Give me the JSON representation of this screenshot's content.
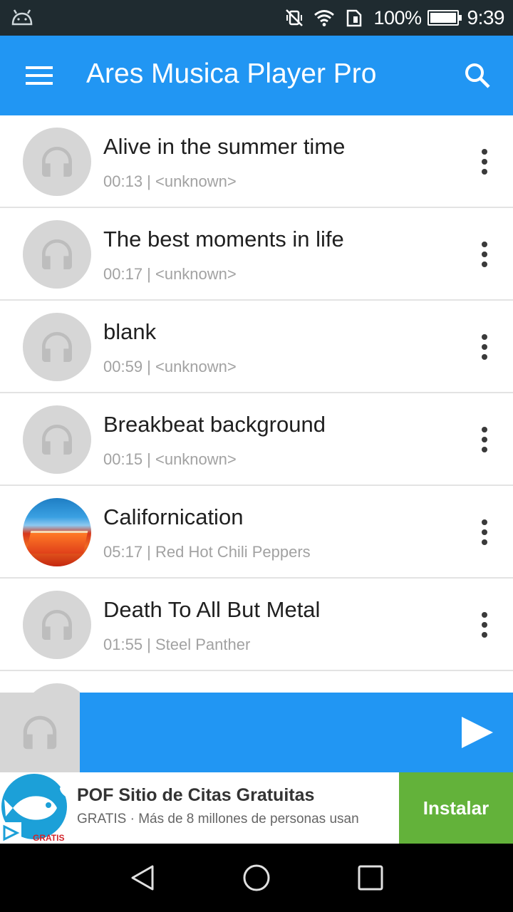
{
  "status_bar": {
    "battery_percent": "100%",
    "time": "9:39",
    "icons": [
      "android-debug-icon",
      "mute-vibrate-icon",
      "wifi-icon",
      "sim-icon",
      "battery-icon"
    ]
  },
  "app_bar": {
    "title": "Ares Musica Player Pro",
    "icons": [
      "menu-icon",
      "search-icon"
    ]
  },
  "songs": [
    {
      "title": "Alive in the summer time",
      "meta": "00:13 | <unknown>",
      "art": "headphones-placeholder"
    },
    {
      "title": "The best moments in life",
      "meta": "00:17 | <unknown>",
      "art": "headphones-placeholder"
    },
    {
      "title": "blank",
      "meta": "00:59 | <unknown>",
      "art": "headphones-placeholder"
    },
    {
      "title": "Breakbeat background",
      "meta": "00:15 | <unknown>",
      "art": "headphones-placeholder"
    },
    {
      "title": "Californication",
      "meta": "05:17 | Red Hot Chili Peppers",
      "art": "album-cover"
    },
    {
      "title": "Death To All But Metal",
      "meta": "01:55 | Steel Panther",
      "art": "headphones-placeholder"
    }
  ],
  "mini_player": {
    "icons": [
      "headphones-icon",
      "play-icon"
    ]
  },
  "ad": {
    "title": "POF Sitio de Citas Gratuitas",
    "description": "GRATIS · Más de 8 millones de personas usan",
    "install_label": "Instalar",
    "logo_badge": "GRATIS",
    "colors": {
      "install": "#63b23a",
      "logo": "#1ca0d8"
    }
  },
  "nav_bar": {
    "icons": [
      "back-icon",
      "home-icon",
      "recents-icon"
    ]
  },
  "colors": {
    "primary": "#2196f3",
    "status_bar": "#1f2b30"
  }
}
